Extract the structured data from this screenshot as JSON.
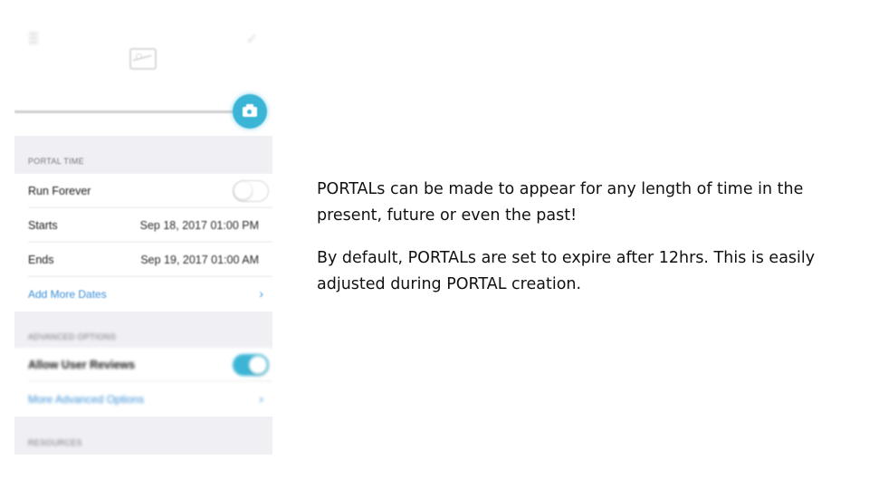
{
  "phone": {
    "portal_time": {
      "header": "PORTAL TIME",
      "run_forever_label": "Run Forever",
      "run_forever_on": false,
      "starts_label": "Starts",
      "starts_value": "Sep 18, 2017 01:00 PM",
      "ends_label": "Ends",
      "ends_value": "Sep 19, 2017 01:00 AM",
      "add_more_dates_label": "Add More Dates"
    },
    "advanced_options": {
      "header": "ADVANCED OPTIONS",
      "allow_user_reviews_label": "Allow User Reviews",
      "allow_user_reviews_on": true,
      "more_advanced_options_label": "More Advanced Options"
    },
    "resources": {
      "header": "RESOURCES"
    },
    "icons": {
      "menu": "menu-icon",
      "check": "checkmark-icon",
      "image": "image-placeholder-icon",
      "camera": "camera-icon",
      "chevron": "chevron-right-icon"
    },
    "colors": {
      "accent": "#3bb5d6",
      "link": "#3a8fd6",
      "section_background": "#efeff4"
    }
  },
  "description": {
    "paragraph1": "PORTALs can be made to appear for any length of time in the present, future or even the past!",
    "paragraph2": "By default, PORTALs are set to expire after 12hrs. This is easily adjusted during PORTAL creation."
  }
}
